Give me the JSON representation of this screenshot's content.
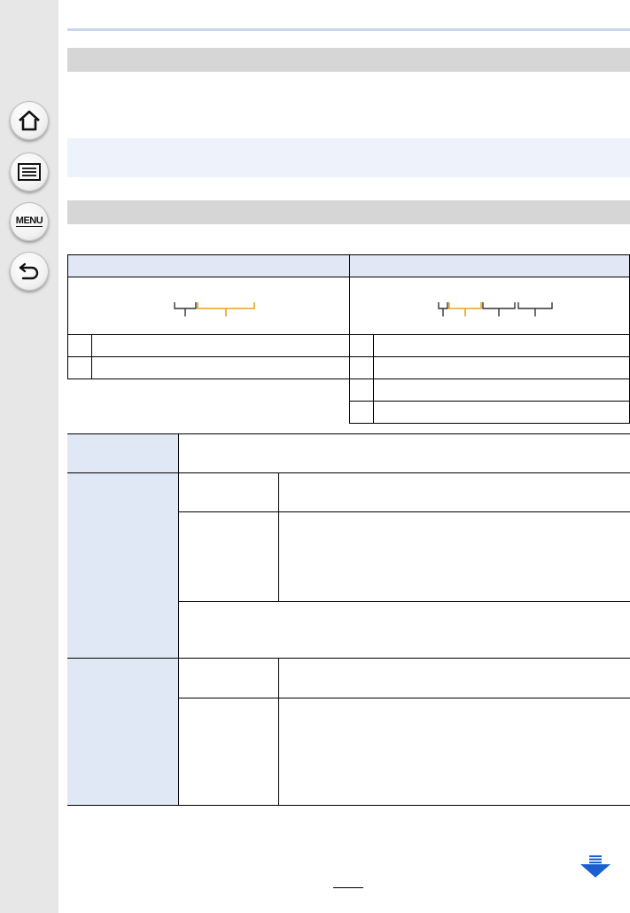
{
  "navigation": {
    "home_icon": "home-icon",
    "menu_list_icon": "menu-list-icon",
    "menu_label": "MENU",
    "back_icon": "back-arrow-icon"
  },
  "colors": {
    "accent_orange": "#f0a020",
    "section_gray": "#d6d6d6",
    "label_blue": "#e1e8f5",
    "note_blue": "#edf2fb",
    "rule_blue": "#c9d5ec",
    "arrow_blue": "#1a5fd0"
  },
  "next_page_icon": "next-page-arrow-icon"
}
